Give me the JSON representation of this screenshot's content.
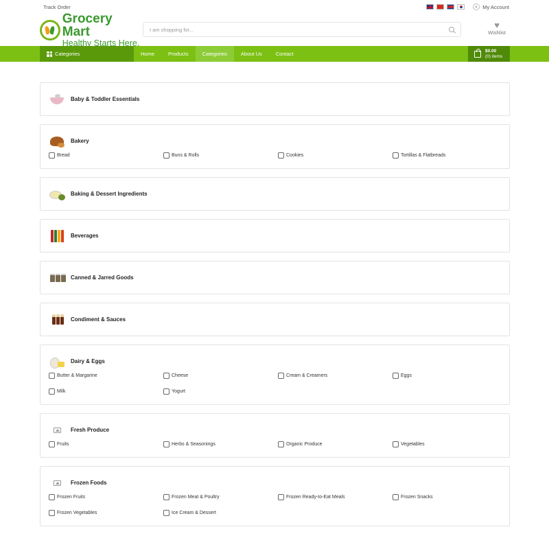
{
  "topbar": {
    "track_order": "Track Order",
    "languages": [
      "english-flag",
      "chinese-flag",
      "khmer-flag",
      "korean-flag"
    ],
    "account": "My Account"
  },
  "header": {
    "logo_title": "Grocery Mart",
    "logo_tagline": "Healthy Starts Here.",
    "search_placeholder": "I am shopping for...",
    "wishlist": "Wishlist"
  },
  "nav": {
    "categories": "Categories",
    "links": [
      "Home",
      "Products",
      "Categories",
      "About Us",
      "Contact"
    ],
    "active": "Categories",
    "cart_total": "$0.00",
    "cart_items": "(0) items"
  },
  "colors": {
    "brand_green": "#7cc013",
    "dark_green": "#5a9a0a",
    "logo_green": "#3a9a2f"
  },
  "categories": [
    {
      "name": "Baby & Toddler Essentials",
      "thumb": "baby",
      "subs": []
    },
    {
      "name": "Bakery",
      "thumb": "bakery",
      "subs": [
        "Bread",
        "Buns & Rolls",
        "Cookies",
        "Tortillas & Flatbreads"
      ]
    },
    {
      "name": "Baking & Dessert Ingredients",
      "thumb": "baking",
      "subs": []
    },
    {
      "name": "Beverages",
      "thumb": "beverages",
      "subs": []
    },
    {
      "name": "Canned & Jarred Goods",
      "thumb": "canned",
      "subs": []
    },
    {
      "name": "Condiment & Sauces",
      "thumb": "condiment",
      "subs": []
    },
    {
      "name": "Dairy & Eggs",
      "thumb": "dairy",
      "subs": [
        "Butter & Margarine",
        "Cheese",
        "Cream & Creamers",
        "Eggs",
        "Milk",
        "Yogurt"
      ]
    },
    {
      "name": "Fresh Produce",
      "thumb": "placeholder",
      "subs": [
        "Fruits",
        "Herbs & Seasonings",
        "Organic Produce",
        "Vegetables"
      ]
    },
    {
      "name": "Frozen Foods",
      "thumb": "placeholder",
      "subs": [
        "Frozen Fruits",
        "Frozen Meat & Poultry",
        "Frozen Ready-to-Eat Meals",
        "Frozen Snacks",
        "Frozen Vegetables",
        "Ice Cream & Dessert"
      ]
    }
  ]
}
